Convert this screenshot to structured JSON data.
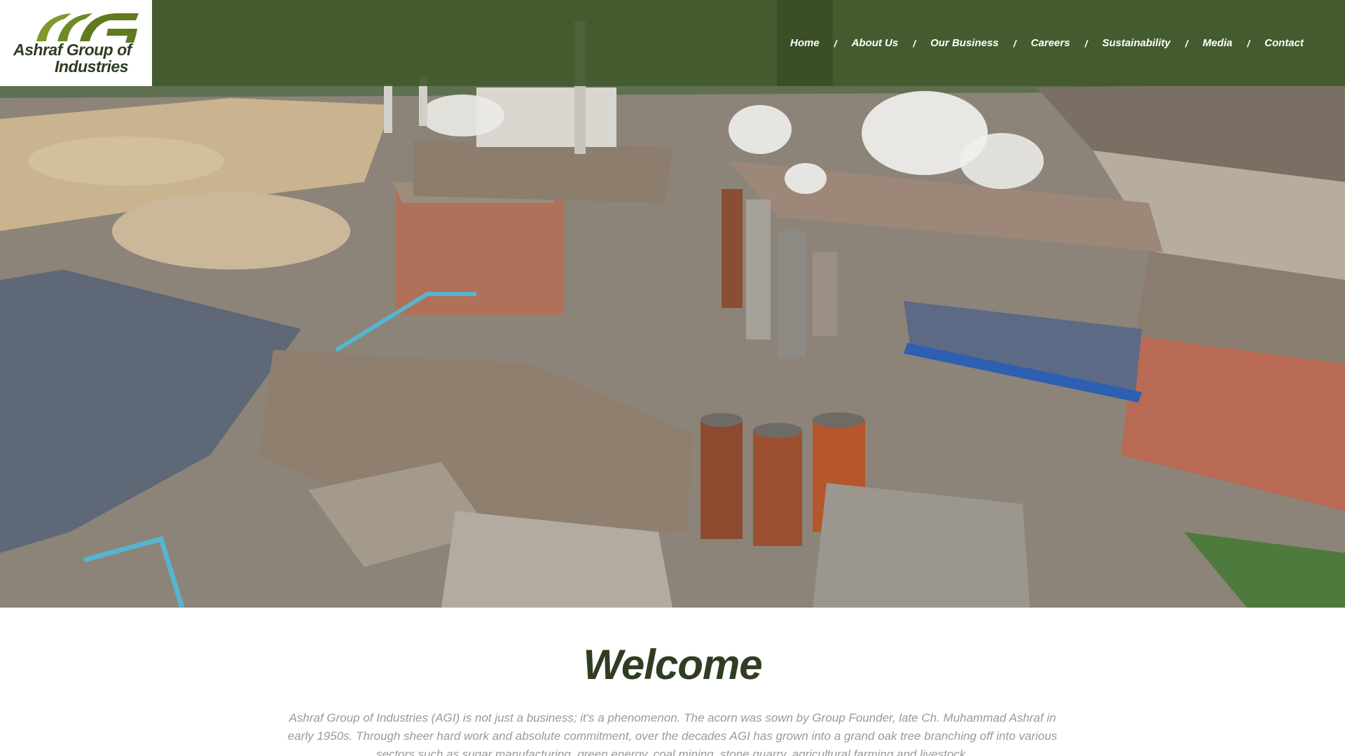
{
  "brand": {
    "name_line1": "Ashraf Group of",
    "name_line2": "Industries",
    "primary_color": "#42592c",
    "accent_color": "#8fa63a",
    "text_color": "#2f3d22"
  },
  "nav": {
    "items": [
      {
        "label": "Home",
        "active": true
      },
      {
        "label": "About Us",
        "active": false
      },
      {
        "label": "Our Business",
        "active": false
      },
      {
        "label": "Careers",
        "active": false
      },
      {
        "label": "Sustainability",
        "active": false
      },
      {
        "label": "Media",
        "active": false
      },
      {
        "label": "Contact",
        "active": false
      }
    ],
    "separator": "/"
  },
  "welcome": {
    "title": "Welcome",
    "body": "Ashraf Group of Industries (AGI) is not just a business; it's a phenomenon. The acorn was sown by Group Founder, late Ch. Muhammad Ashraf in early 1950s. Through sheer hard work and absolute commitment, over the decades AGI has grown into a grand oak tree branching off into various sectors such as sugar manufacturing, green energy, coal mining, stone quarry, agricultural farming and livestock."
  }
}
